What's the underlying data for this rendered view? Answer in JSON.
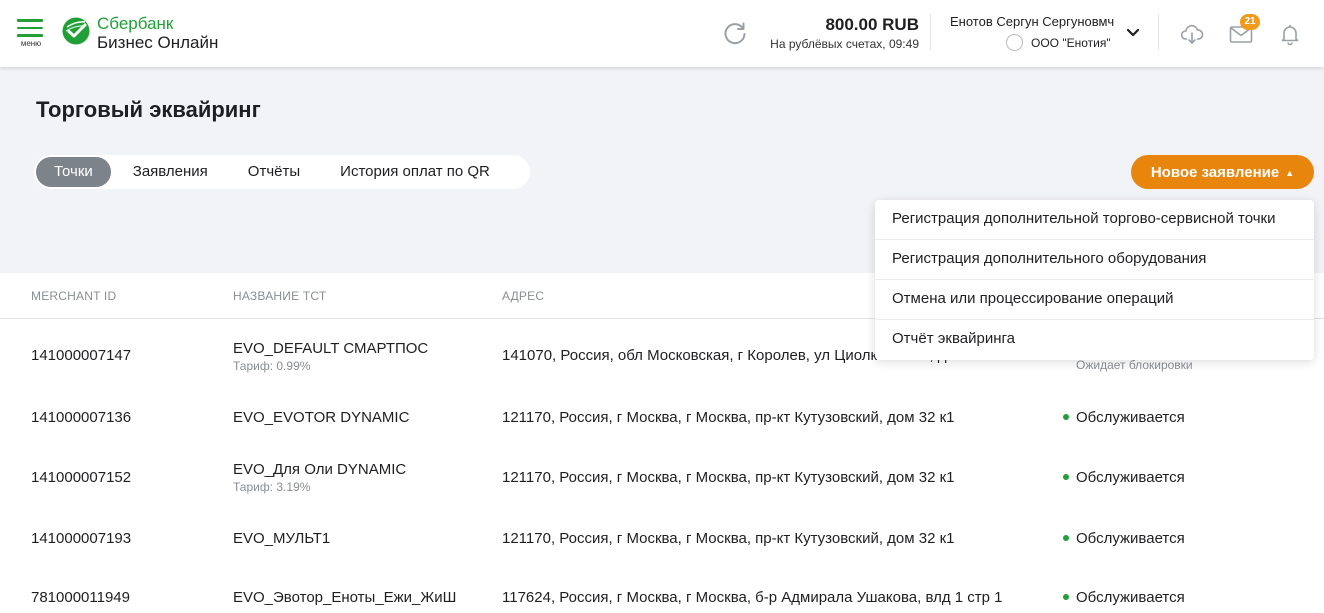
{
  "header": {
    "menu_label": "меню",
    "brand_line1": "Сбербанк",
    "brand_line2": "Бизнес Онлайн",
    "balance_amount": "800.00 RUB",
    "balance_sub": "На рублёвых счетах, 09:49",
    "user_name": "Енотов Сергун Сергуновмч",
    "org_name": "ООО \"Енотия\"",
    "notifications_count": "21",
    "icons": [
      "refresh-icon",
      "chevron-down-icon",
      "cloud-download-icon",
      "mail-icon",
      "bell-icon"
    ],
    "colors": {
      "brand_green": "#21a038",
      "badge": "#f19b1d"
    }
  },
  "page": {
    "title": "Торговый эквайринг"
  },
  "tabs": [
    {
      "label": "Точки",
      "active": true
    },
    {
      "label": "Заявления",
      "active": false
    },
    {
      "label": "Отчёты",
      "active": false
    },
    {
      "label": "История оплат по QR",
      "active": false
    }
  ],
  "new_button": {
    "label": "Новое заявление",
    "arrow": "▲",
    "color": "#e8850c"
  },
  "dropdown": {
    "items": [
      "Регистрация дополнительной торгово-сервисной точки",
      "Регистрация дополнительного оборудования",
      "Отмена или процессирование операций",
      "Отчёт эквайринга"
    ]
  },
  "table": {
    "columns": [
      "MERCHANT ID",
      "НАЗВАНИЕ ТСТ",
      "АДРЕС"
    ],
    "rows": [
      {
        "merchant_id": "141000007147",
        "name": "EVO_DEFAULT СМАРТПОС",
        "tariff": "Тариф: 0.99%",
        "address": "141070, Россия, обл Московская, г Королев, ул Циолковского, дом 27",
        "status": "",
        "status_sub": "Ожидает блокировки"
      },
      {
        "merchant_id": "141000007136",
        "name": "EVO_EVOTOR DYNAMIC",
        "tariff": "",
        "address": "121170, Россия, г Москва, г Москва, пр-кт Кутузовский, дом 32 к1",
        "status": "Обслуживается",
        "status_sub": ""
      },
      {
        "merchant_id": "141000007152",
        "name": "EVO_Для Оли DYNAMIC",
        "tariff": "Тариф: 3.19%",
        "address": "121170, Россия, г Москва, г Москва, пр-кт Кутузовский, дом 32 к1",
        "status": "Обслуживается",
        "status_sub": ""
      },
      {
        "merchant_id": "141000007193",
        "name": "EVO_МУЛЬТ1",
        "tariff": "",
        "address": "121170, Россия, г Москва, г Москва, пр-кт Кутузовский, дом 32 к1",
        "status": "Обслуживается",
        "status_sub": ""
      },
      {
        "merchant_id": "781000011949",
        "name": "EVO_Эвотор_Еноты_Ежи_ЖиШ",
        "tariff": "",
        "address": "117624, Россия, г Москва, г Москва, б-р Адмирала Ушакова, влд 1 стр 1",
        "status": "Обслуживается",
        "status_sub": ""
      }
    ],
    "status_color": "#21a038"
  }
}
